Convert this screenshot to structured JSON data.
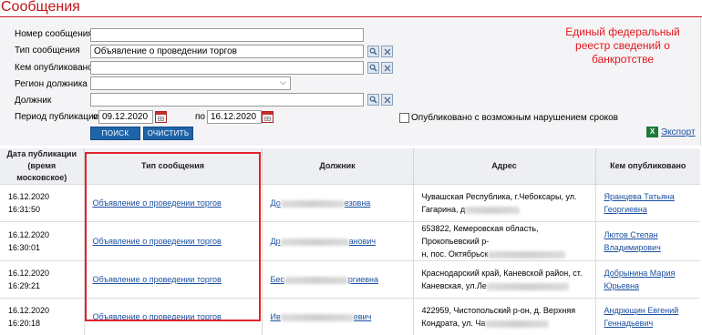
{
  "page_title": "Сообщения",
  "side_note": "Единый федеральный реестр сведений о банкротстве",
  "form": {
    "message_number_label": "Номер сообщения",
    "message_number_value": "",
    "message_type_label": "Тип сообщения",
    "message_type_value": "Объявление о проведении торгов",
    "published_by_label": "Кем опубликовано",
    "published_by_value": "",
    "region_label": "Регион должника",
    "region_value": "",
    "debtor_label": "Должник",
    "debtor_value": "",
    "period_label": "Период публикации",
    "from_prefix": "с",
    "date_from": "09.12.2020",
    "to_prefix": "по",
    "date_to": "16.12.2020",
    "violation_checkbox_label": "Опубликовано с возможным нарушением сроков",
    "violation_checked": false,
    "search_button": "ПОИСК",
    "clear_button": "ОЧИСТИТЬ",
    "export_label": "Экспорт",
    "export_icon_glyph": "X"
  },
  "icons": {
    "search": "magnifier-icon",
    "clear": "close-icon",
    "calendar": "calendar-icon",
    "excel": "excel-icon",
    "dropdown": "chevron-down-icon"
  },
  "colors": {
    "title": "#c0141b",
    "note": "#e3141b",
    "button": "#1f64a8",
    "link": "#1a4fa0",
    "highlight": "#e0242a"
  },
  "table": {
    "headers": [
      "Дата публикации (время московское)",
      "Тип сообщения",
      "Должник",
      "Адрес",
      "Кем опубликовано"
    ],
    "rows": [
      {
        "date": "16.12.2020 16:31:50",
        "type": "Объявление о проведении торгов",
        "debtor_start": "До",
        "debtor_end": "езовна",
        "address_line1": "Чувашская Республика, г.Чебоксары, ул.",
        "address_line2": "Гагарина, д",
        "publisher_line1": "Яранцева Татьяна",
        "publisher_line2": "Георгиевна"
      },
      {
        "date": "16.12.2020 16:30:01",
        "type": "Объявление о проведении торгов",
        "debtor_start": "Др",
        "debtor_end": "анович",
        "address_line1": "653822, Кемеровская область, Прокопьевский р-",
        "address_line2": "н, пос. Октябрьск",
        "publisher_line1": "Лютов Степан",
        "publisher_line2": "Владимирович"
      },
      {
        "date": "16.12.2020 16:29:21",
        "type": "Объявление о проведении торгов",
        "debtor_start": "Бес",
        "debtor_end": "ргиевна",
        "address_line1": "Краснодарский край, Каневской район, ст.",
        "address_line2": "Каневская, ул.Ле",
        "publisher_line1": "Добрынина Мария",
        "publisher_line2": "Юрьевна"
      },
      {
        "date": "16.12.2020 16:20:18",
        "type": "Объявление о проведении торгов",
        "debtor_start": "Ив",
        "debtor_end": "евич",
        "address_line1": "422959, Чистопольский р-он, д. Верхняя",
        "address_line2": "Кондрата, ул. Ча",
        "publisher_line1": "Андрющин Евгений",
        "publisher_line2": "Геннадьевич"
      }
    ]
  }
}
